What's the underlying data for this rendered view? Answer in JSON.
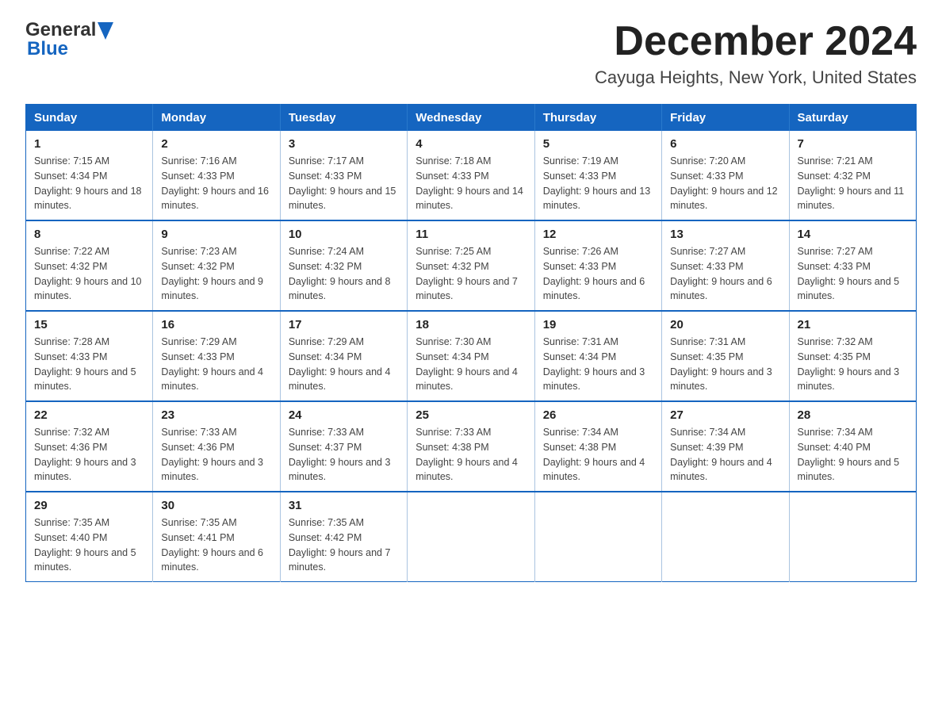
{
  "header": {
    "logo_general": "General",
    "logo_blue": "Blue",
    "main_title": "December 2024",
    "subtitle": "Cayuga Heights, New York, United States"
  },
  "weekdays": [
    "Sunday",
    "Monday",
    "Tuesday",
    "Wednesday",
    "Thursday",
    "Friday",
    "Saturday"
  ],
  "weeks": [
    [
      {
        "day": "1",
        "sunrise": "7:15 AM",
        "sunset": "4:34 PM",
        "daylight": "9 hours and 18 minutes."
      },
      {
        "day": "2",
        "sunrise": "7:16 AM",
        "sunset": "4:33 PM",
        "daylight": "9 hours and 16 minutes."
      },
      {
        "day": "3",
        "sunrise": "7:17 AM",
        "sunset": "4:33 PM",
        "daylight": "9 hours and 15 minutes."
      },
      {
        "day": "4",
        "sunrise": "7:18 AM",
        "sunset": "4:33 PM",
        "daylight": "9 hours and 14 minutes."
      },
      {
        "day": "5",
        "sunrise": "7:19 AM",
        "sunset": "4:33 PM",
        "daylight": "9 hours and 13 minutes."
      },
      {
        "day": "6",
        "sunrise": "7:20 AM",
        "sunset": "4:33 PM",
        "daylight": "9 hours and 12 minutes."
      },
      {
        "day": "7",
        "sunrise": "7:21 AM",
        "sunset": "4:32 PM",
        "daylight": "9 hours and 11 minutes."
      }
    ],
    [
      {
        "day": "8",
        "sunrise": "7:22 AM",
        "sunset": "4:32 PM",
        "daylight": "9 hours and 10 minutes."
      },
      {
        "day": "9",
        "sunrise": "7:23 AM",
        "sunset": "4:32 PM",
        "daylight": "9 hours and 9 minutes."
      },
      {
        "day": "10",
        "sunrise": "7:24 AM",
        "sunset": "4:32 PM",
        "daylight": "9 hours and 8 minutes."
      },
      {
        "day": "11",
        "sunrise": "7:25 AM",
        "sunset": "4:32 PM",
        "daylight": "9 hours and 7 minutes."
      },
      {
        "day": "12",
        "sunrise": "7:26 AM",
        "sunset": "4:33 PM",
        "daylight": "9 hours and 6 minutes."
      },
      {
        "day": "13",
        "sunrise": "7:27 AM",
        "sunset": "4:33 PM",
        "daylight": "9 hours and 6 minutes."
      },
      {
        "day": "14",
        "sunrise": "7:27 AM",
        "sunset": "4:33 PM",
        "daylight": "9 hours and 5 minutes."
      }
    ],
    [
      {
        "day": "15",
        "sunrise": "7:28 AM",
        "sunset": "4:33 PM",
        "daylight": "9 hours and 5 minutes."
      },
      {
        "day": "16",
        "sunrise": "7:29 AM",
        "sunset": "4:33 PM",
        "daylight": "9 hours and 4 minutes."
      },
      {
        "day": "17",
        "sunrise": "7:29 AM",
        "sunset": "4:34 PM",
        "daylight": "9 hours and 4 minutes."
      },
      {
        "day": "18",
        "sunrise": "7:30 AM",
        "sunset": "4:34 PM",
        "daylight": "9 hours and 4 minutes."
      },
      {
        "day": "19",
        "sunrise": "7:31 AM",
        "sunset": "4:34 PM",
        "daylight": "9 hours and 3 minutes."
      },
      {
        "day": "20",
        "sunrise": "7:31 AM",
        "sunset": "4:35 PM",
        "daylight": "9 hours and 3 minutes."
      },
      {
        "day": "21",
        "sunrise": "7:32 AM",
        "sunset": "4:35 PM",
        "daylight": "9 hours and 3 minutes."
      }
    ],
    [
      {
        "day": "22",
        "sunrise": "7:32 AM",
        "sunset": "4:36 PM",
        "daylight": "9 hours and 3 minutes."
      },
      {
        "day": "23",
        "sunrise": "7:33 AM",
        "sunset": "4:36 PM",
        "daylight": "9 hours and 3 minutes."
      },
      {
        "day": "24",
        "sunrise": "7:33 AM",
        "sunset": "4:37 PM",
        "daylight": "9 hours and 3 minutes."
      },
      {
        "day": "25",
        "sunrise": "7:33 AM",
        "sunset": "4:38 PM",
        "daylight": "9 hours and 4 minutes."
      },
      {
        "day": "26",
        "sunrise": "7:34 AM",
        "sunset": "4:38 PM",
        "daylight": "9 hours and 4 minutes."
      },
      {
        "day": "27",
        "sunrise": "7:34 AM",
        "sunset": "4:39 PM",
        "daylight": "9 hours and 4 minutes."
      },
      {
        "day": "28",
        "sunrise": "7:34 AM",
        "sunset": "4:40 PM",
        "daylight": "9 hours and 5 minutes."
      }
    ],
    [
      {
        "day": "29",
        "sunrise": "7:35 AM",
        "sunset": "4:40 PM",
        "daylight": "9 hours and 5 minutes."
      },
      {
        "day": "30",
        "sunrise": "7:35 AM",
        "sunset": "4:41 PM",
        "daylight": "9 hours and 6 minutes."
      },
      {
        "day": "31",
        "sunrise": "7:35 AM",
        "sunset": "4:42 PM",
        "daylight": "9 hours and 7 minutes."
      },
      null,
      null,
      null,
      null
    ]
  ]
}
